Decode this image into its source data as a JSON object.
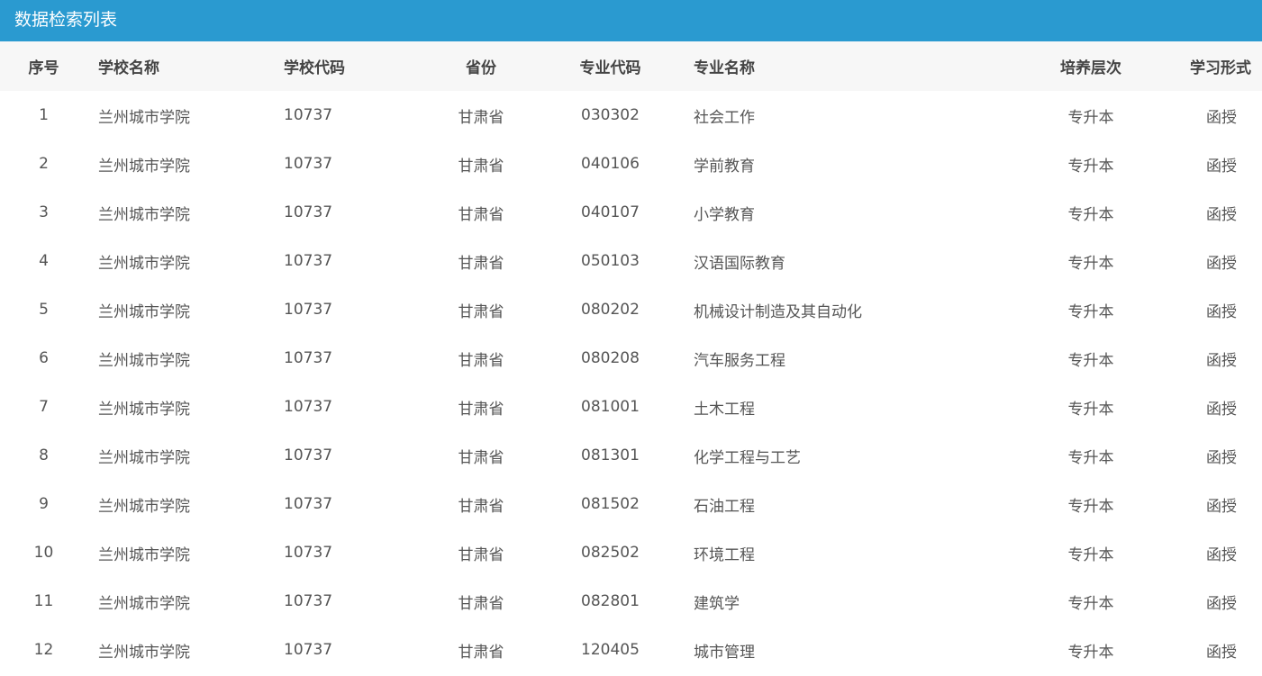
{
  "panel": {
    "title": "数据检索列表"
  },
  "table": {
    "headers": {
      "index": "序号",
      "school_name": "学校名称",
      "school_code": "学校代码",
      "province": "省份",
      "major_code": "专业代码",
      "major_name": "专业名称",
      "level": "培养层次",
      "study_mode": "学习形式"
    },
    "rows": [
      {
        "index": "1",
        "school_name": "兰州城市学院",
        "school_code": "10737",
        "province": "甘肃省",
        "major_code": "030302",
        "major_name": "社会工作",
        "level": "专升本",
        "study_mode": "函授"
      },
      {
        "index": "2",
        "school_name": "兰州城市学院",
        "school_code": "10737",
        "province": "甘肃省",
        "major_code": "040106",
        "major_name": "学前教育",
        "level": "专升本",
        "study_mode": "函授"
      },
      {
        "index": "3",
        "school_name": "兰州城市学院",
        "school_code": "10737",
        "province": "甘肃省",
        "major_code": "040107",
        "major_name": "小学教育",
        "level": "专升本",
        "study_mode": "函授"
      },
      {
        "index": "4",
        "school_name": "兰州城市学院",
        "school_code": "10737",
        "province": "甘肃省",
        "major_code": "050103",
        "major_name": "汉语国际教育",
        "level": "专升本",
        "study_mode": "函授"
      },
      {
        "index": "5",
        "school_name": "兰州城市学院",
        "school_code": "10737",
        "province": "甘肃省",
        "major_code": "080202",
        "major_name": "机械设计制造及其自动化",
        "level": "专升本",
        "study_mode": "函授"
      },
      {
        "index": "6",
        "school_name": "兰州城市学院",
        "school_code": "10737",
        "province": "甘肃省",
        "major_code": "080208",
        "major_name": "汽车服务工程",
        "level": "专升本",
        "study_mode": "函授"
      },
      {
        "index": "7",
        "school_name": "兰州城市学院",
        "school_code": "10737",
        "province": "甘肃省",
        "major_code": "081001",
        "major_name": "土木工程",
        "level": "专升本",
        "study_mode": "函授"
      },
      {
        "index": "8",
        "school_name": "兰州城市学院",
        "school_code": "10737",
        "province": "甘肃省",
        "major_code": "081301",
        "major_name": "化学工程与工艺",
        "level": "专升本",
        "study_mode": "函授"
      },
      {
        "index": "9",
        "school_name": "兰州城市学院",
        "school_code": "10737",
        "province": "甘肃省",
        "major_code": "081502",
        "major_name": "石油工程",
        "level": "专升本",
        "study_mode": "函授"
      },
      {
        "index": "10",
        "school_name": "兰州城市学院",
        "school_code": "10737",
        "province": "甘肃省",
        "major_code": "082502",
        "major_name": "环境工程",
        "level": "专升本",
        "study_mode": "函授"
      },
      {
        "index": "11",
        "school_name": "兰州城市学院",
        "school_code": "10737",
        "province": "甘肃省",
        "major_code": "082801",
        "major_name": "建筑学",
        "level": "专升本",
        "study_mode": "函授"
      },
      {
        "index": "12",
        "school_name": "兰州城市学院",
        "school_code": "10737",
        "province": "甘肃省",
        "major_code": "120405",
        "major_name": "城市管理",
        "level": "专升本",
        "study_mode": "函授"
      }
    ]
  },
  "colors": {
    "title_bar": "#2a9ad0",
    "header_row": "#f7f7f7"
  }
}
